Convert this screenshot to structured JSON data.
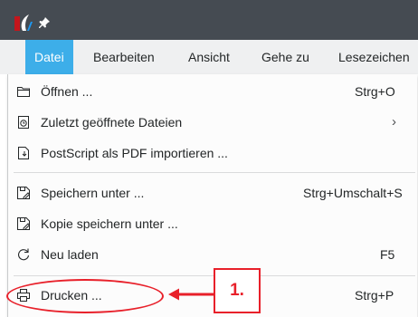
{
  "menubar": {
    "tabs": [
      {
        "label": "Datei",
        "active": true
      },
      {
        "label": "Bearbeiten",
        "active": false
      },
      {
        "label": "Ansicht",
        "active": false
      },
      {
        "label": "Gehe zu",
        "active": false
      },
      {
        "label": "Lesezeichen",
        "active": false
      }
    ]
  },
  "file_menu": {
    "items": [
      {
        "icon": "folder-open-icon",
        "label": "Öffnen ...",
        "shortcut": "Strg+O"
      },
      {
        "icon": "recent-files-icon",
        "label": "Zuletzt geöffnete Dateien",
        "submenu_arrow": "›"
      },
      {
        "icon": "import-icon",
        "label": "PostScript als PDF importieren ...",
        "shortcut": ""
      },
      {
        "icon": "save-as-icon",
        "label": "Speichern unter ...",
        "shortcut": "Strg+Umschalt+S"
      },
      {
        "icon": "save-copy-icon",
        "label": "Kopie speichern unter ...",
        "shortcut": ""
      },
      {
        "icon": "reload-icon",
        "label": "Neu laden",
        "shortcut": "F5"
      },
      {
        "icon": "printer-icon",
        "label": "Drucken ...",
        "shortcut": "Strg+P"
      }
    ]
  },
  "annotation": {
    "step_label": "1.",
    "color": "#e8202a"
  },
  "colors": {
    "titlebar": "#454b52",
    "menubar": "#eff0f1",
    "accent": "#3daee9",
    "menu_background": "#fcfcfc",
    "text": "#232627"
  }
}
